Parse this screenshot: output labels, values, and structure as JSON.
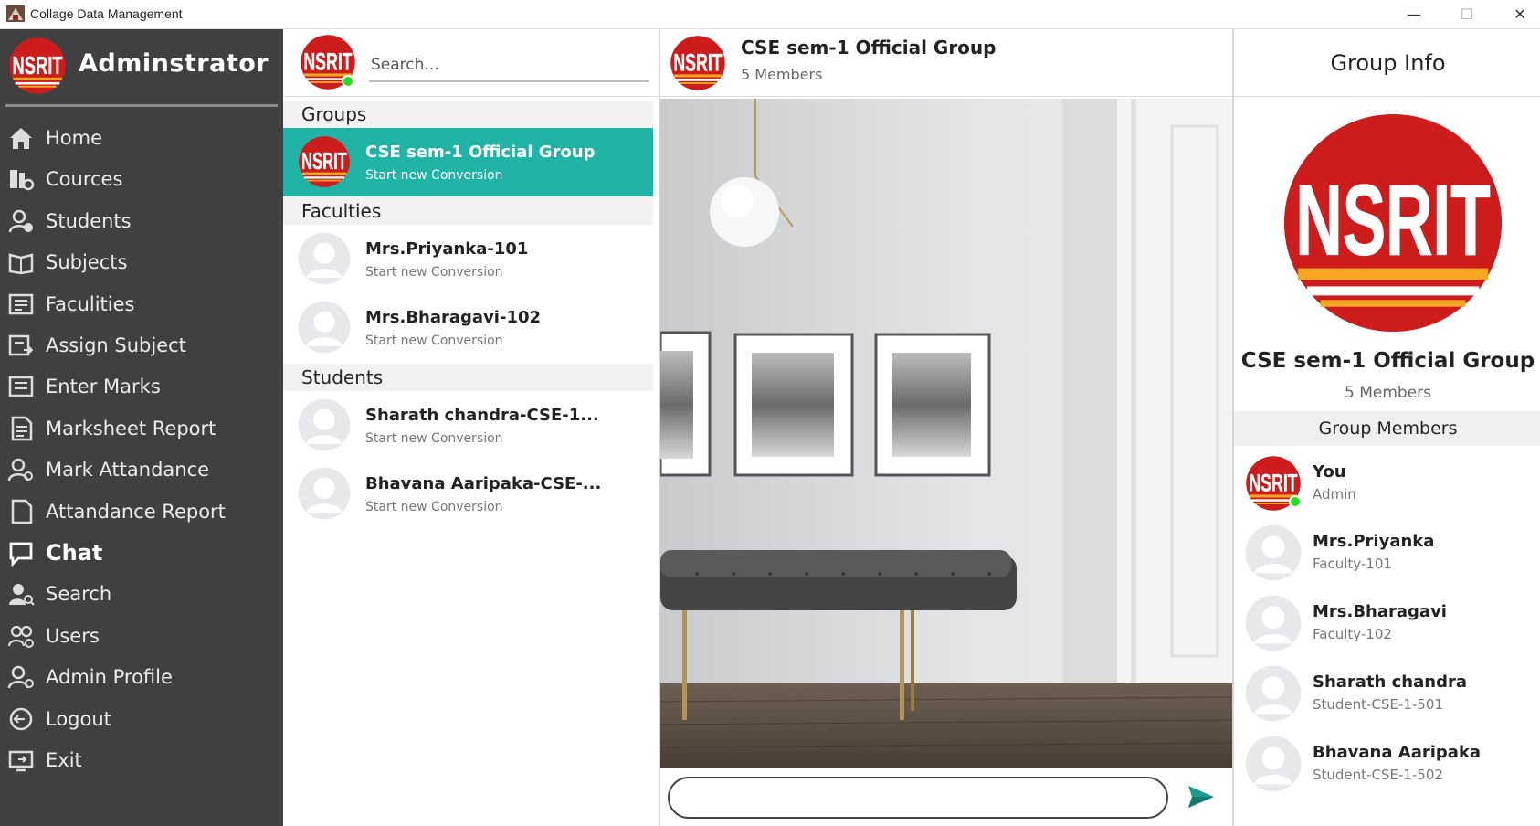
{
  "window": {
    "title": "Collage Data Management",
    "min": "—",
    "max": "☐",
    "close": "✕"
  },
  "sidebar": {
    "title": "Adminstrator",
    "logo_text": "NSRIT",
    "items": [
      {
        "label": "Home",
        "icon": "home-icon"
      },
      {
        "label": "Cources",
        "icon": "courses-icon"
      },
      {
        "label": "Students",
        "icon": "students-icon"
      },
      {
        "label": "Subjects",
        "icon": "book-icon"
      },
      {
        "label": "Faculities",
        "icon": "faculty-icon"
      },
      {
        "label": "Assign Subject",
        "icon": "assign-icon"
      },
      {
        "label": "Enter Marks",
        "icon": "marks-icon"
      },
      {
        "label": "Marksheet Report",
        "icon": "report-icon"
      },
      {
        "label": "Mark Attandance",
        "icon": "attendance-icon"
      },
      {
        "label": "Attandance Report",
        "icon": "document-icon"
      },
      {
        "label": "Chat",
        "icon": "chat-icon",
        "active": true
      },
      {
        "label": "Search",
        "icon": "search-user-icon"
      },
      {
        "label": "Users",
        "icon": "users-icon"
      },
      {
        "label": "Admin Profile",
        "icon": "profile-icon"
      },
      {
        "label": "Logout",
        "icon": "logout-icon"
      },
      {
        "label": "Exit",
        "icon": "exit-icon"
      }
    ]
  },
  "list": {
    "search_placeholder": "Search...",
    "groups_title": "Groups",
    "faculties_title": "Faculties",
    "students_title": "Students",
    "groups": [
      {
        "name": "CSE sem-1 Official Group",
        "sub": "Start new Conversion"
      }
    ],
    "faculties": [
      {
        "name": "Mrs.Priyanka-101",
        "sub": "Start new Conversion"
      },
      {
        "name": "Mrs.Bharagavi-102",
        "sub": "Start new Conversion"
      }
    ],
    "students": [
      {
        "name": "Sharath chandra-CSE-1...",
        "sub": "Start new Conversion"
      },
      {
        "name": "Bhavana Aaripaka-CSE-...",
        "sub": "Start new Conversion"
      }
    ]
  },
  "chat": {
    "group_name": "CSE sem-1 Official Group",
    "members_count": "5 Members",
    "message_value": "",
    "message_placeholder": ""
  },
  "info": {
    "title": "Group Info",
    "group_name": "CSE sem-1 Official Group",
    "members_count": "5 Members",
    "members_title": "Group Members",
    "members": [
      {
        "name": "You",
        "sub": "Admin",
        "logo": true
      },
      {
        "name": "Mrs.Priyanka",
        "sub": "Faculty-101"
      },
      {
        "name": "Mrs.Bharagavi",
        "sub": "Faculty-102"
      },
      {
        "name": "Sharath chandra",
        "sub": "Student-CSE-1-501"
      },
      {
        "name": "Bhavana Aaripaka",
        "sub": "Student-CSE-1-502"
      }
    ]
  },
  "colors": {
    "sidebar": "#404040",
    "accent": "#21b3a6",
    "logo_red": "#cc1818",
    "online": "#22dd22"
  }
}
